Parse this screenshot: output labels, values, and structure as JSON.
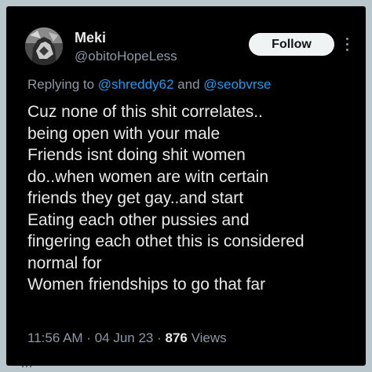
{
  "author": {
    "display_name": "Meki",
    "handle": "@obitoHopeLess"
  },
  "follow_button": {
    "label": "Follow"
  },
  "more_icon": "more-horizontal-icon",
  "reply": {
    "prefix": "Replying to ",
    "mention1": "@shreddy62",
    "joiner": " and ",
    "mention2": "@seobvrse"
  },
  "tweet": {
    "lines": [
      "Cuz none of this shit correlates..",
      "being open with your male",
      "Friends isnt doing shit women",
      "do..when women are witn certain",
      "friends they get gay..and start",
      "Eating each other pussies and",
      "fingering each othet this is considered",
      "normal for",
      "Women friendships to go that far"
    ]
  },
  "meta": {
    "time": "11:56 AM",
    "sep1": " · ",
    "date": "04 Jun 23",
    "sep2": " · ",
    "views_count": "876",
    "views_label": " Views"
  },
  "colors": {
    "background": "#000000",
    "text_primary": "#e7e9ea",
    "text_secondary": "#8b98a5",
    "link": "#1d9bf0",
    "follow_bg": "#eff3f4",
    "outer_border": "#b9c7cd"
  }
}
